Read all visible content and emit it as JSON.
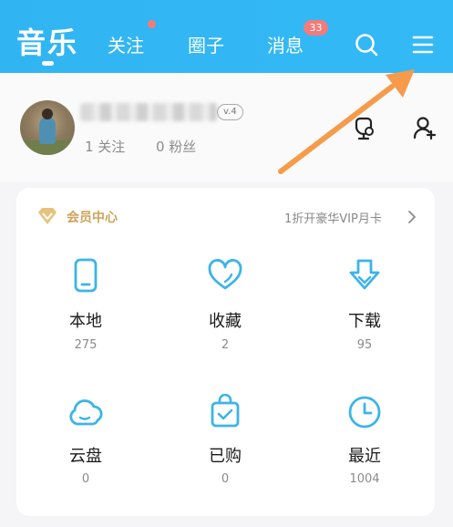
{
  "header": {
    "tabs": [
      {
        "label": "音乐"
      },
      {
        "label": "关注"
      },
      {
        "label": "圈子"
      },
      {
        "label": "消息"
      }
    ],
    "message_badge": "33"
  },
  "profile": {
    "level": "v.4",
    "follow_stat": "1 关注",
    "fans_stat": "0 粉丝"
  },
  "vip": {
    "label": "会员中心",
    "promo": "1折开豪华VIP月卡"
  },
  "tiles": [
    {
      "label": "本地",
      "count": "275",
      "icon": "phone-icon"
    },
    {
      "label": "收藏",
      "count": "2",
      "icon": "heart-icon"
    },
    {
      "label": "下载",
      "count": "95",
      "icon": "download-icon"
    },
    {
      "label": "云盘",
      "count": "0",
      "icon": "cloud-icon"
    },
    {
      "label": "已购",
      "count": "0",
      "icon": "purchased-bag-icon"
    },
    {
      "label": "最近",
      "count": "1004",
      "icon": "clock-icon"
    }
  ],
  "colors": {
    "header": "#33b9f6",
    "accent_blue": "#3cb4ea",
    "vip_gold": "#cfa25a",
    "annotation_arrow": "#f59b4a",
    "badge_red": "#f27b7b"
  }
}
